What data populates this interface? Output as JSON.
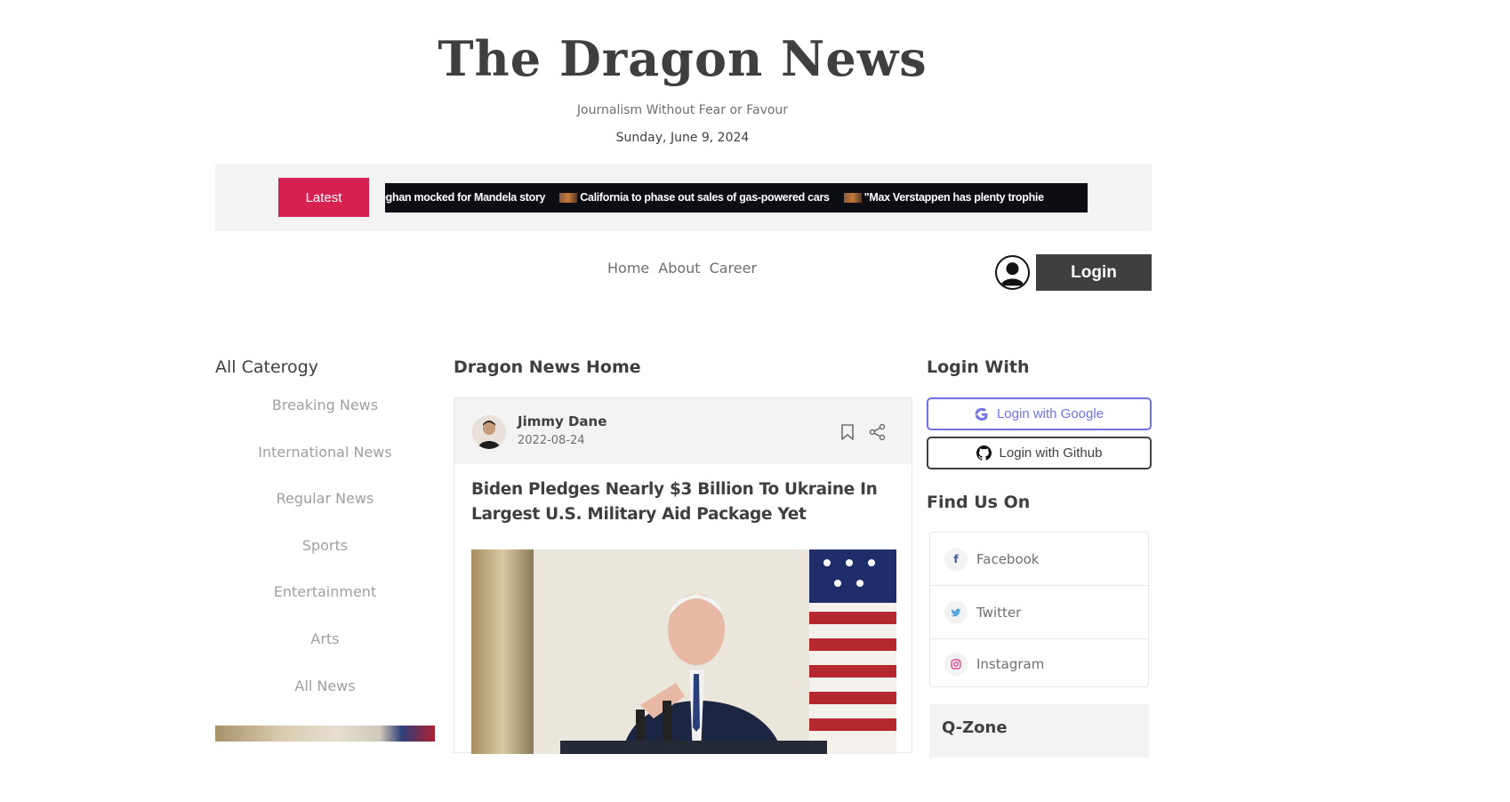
{
  "header": {
    "logo": "The Dragon News",
    "tagline": "Journalism Without Fear or Favour",
    "date": "Sunday, June 9, 2024"
  },
  "ticker": {
    "label": "Latest",
    "items": [
      "eghan mocked for Mandela story",
      "California to phase out sales of gas-powered cars",
      "\"Max Verstappen has plenty trophie"
    ]
  },
  "nav": {
    "items": [
      "Home",
      "About",
      "Career"
    ],
    "login_label": "Login"
  },
  "sidebar_left": {
    "title": "All Caterogy",
    "categories": [
      "Breaking News",
      "International News",
      "Regular News",
      "Sports",
      "Entertainment",
      "Arts",
      "All News"
    ]
  },
  "main": {
    "title": "Dragon News Home",
    "article": {
      "author": "Jimmy Dane",
      "date": "2022-08-24",
      "title": "Biden Pledges Nearly $3 Billion To Ukraine In Largest U.S. Military Aid Package Yet"
    }
  },
  "sidebar_right": {
    "login_title": "Login With",
    "google_label": "Login with Google",
    "github_label": "Login with Github",
    "find_title": "Find Us On",
    "social": [
      {
        "name": "Facebook",
        "icon": "facebook-icon",
        "color": "#3b5998"
      },
      {
        "name": "Twitter",
        "icon": "twitter-icon",
        "color": "#58a7de"
      },
      {
        "name": "Instagram",
        "icon": "instagram-icon",
        "color": "#d82d7e"
      }
    ],
    "qzone_title": "Q-Zone"
  },
  "colors": {
    "accent": "#d72050",
    "dark": "#403f3f",
    "google": "#6f72e8"
  }
}
